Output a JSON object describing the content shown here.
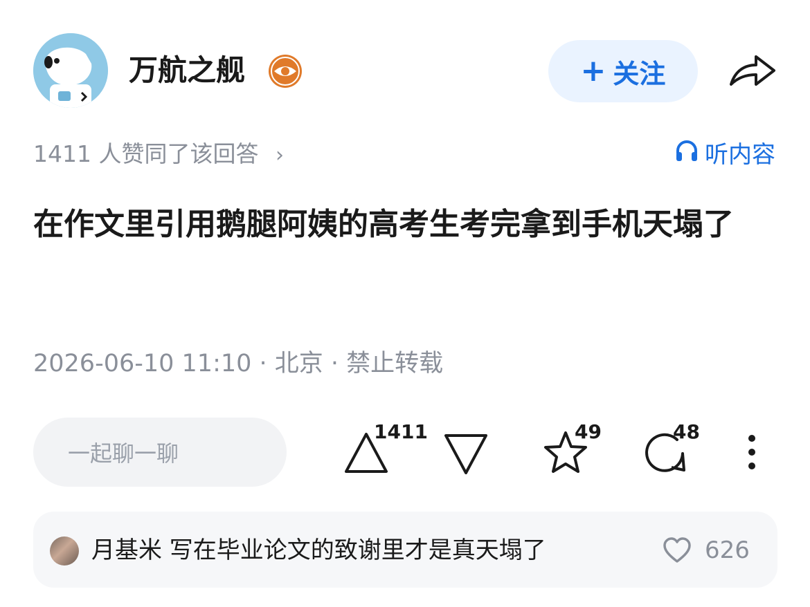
{
  "header": {
    "author_name": "万航之舰",
    "follow_label": "关注",
    "follow_plus": "+"
  },
  "meta": {
    "likes_text": "1411 人赞同了该回答",
    "likes_chevron": "›",
    "listen_label": "听内容"
  },
  "post": {
    "title": "在作文里引用鹅腿阿姨的高考生考完拿到手机天塌了",
    "datetime_line": "2026-06-10 11:10 · 北京 · 禁止转载"
  },
  "actions": {
    "chat_placeholder": "一起聊一聊",
    "upvote_count": "1411",
    "favorite_count": "49",
    "comment_count": "48"
  },
  "comment_preview": {
    "text": "月基米 写在毕业论文的致谢里才是真天塌了",
    "like_count": "626"
  },
  "colors": {
    "accent": "#1b6fe0",
    "follow_bg": "#eaf3ff",
    "muted_text": "#8a8f99",
    "badge_orange": "#e07a2a"
  },
  "icons": [
    "avatar",
    "eye-badge-icon",
    "share-icon",
    "headphones-icon",
    "upvote-icon",
    "downvote-icon",
    "star-icon",
    "comment-icon",
    "more-icon",
    "heart-icon"
  ]
}
